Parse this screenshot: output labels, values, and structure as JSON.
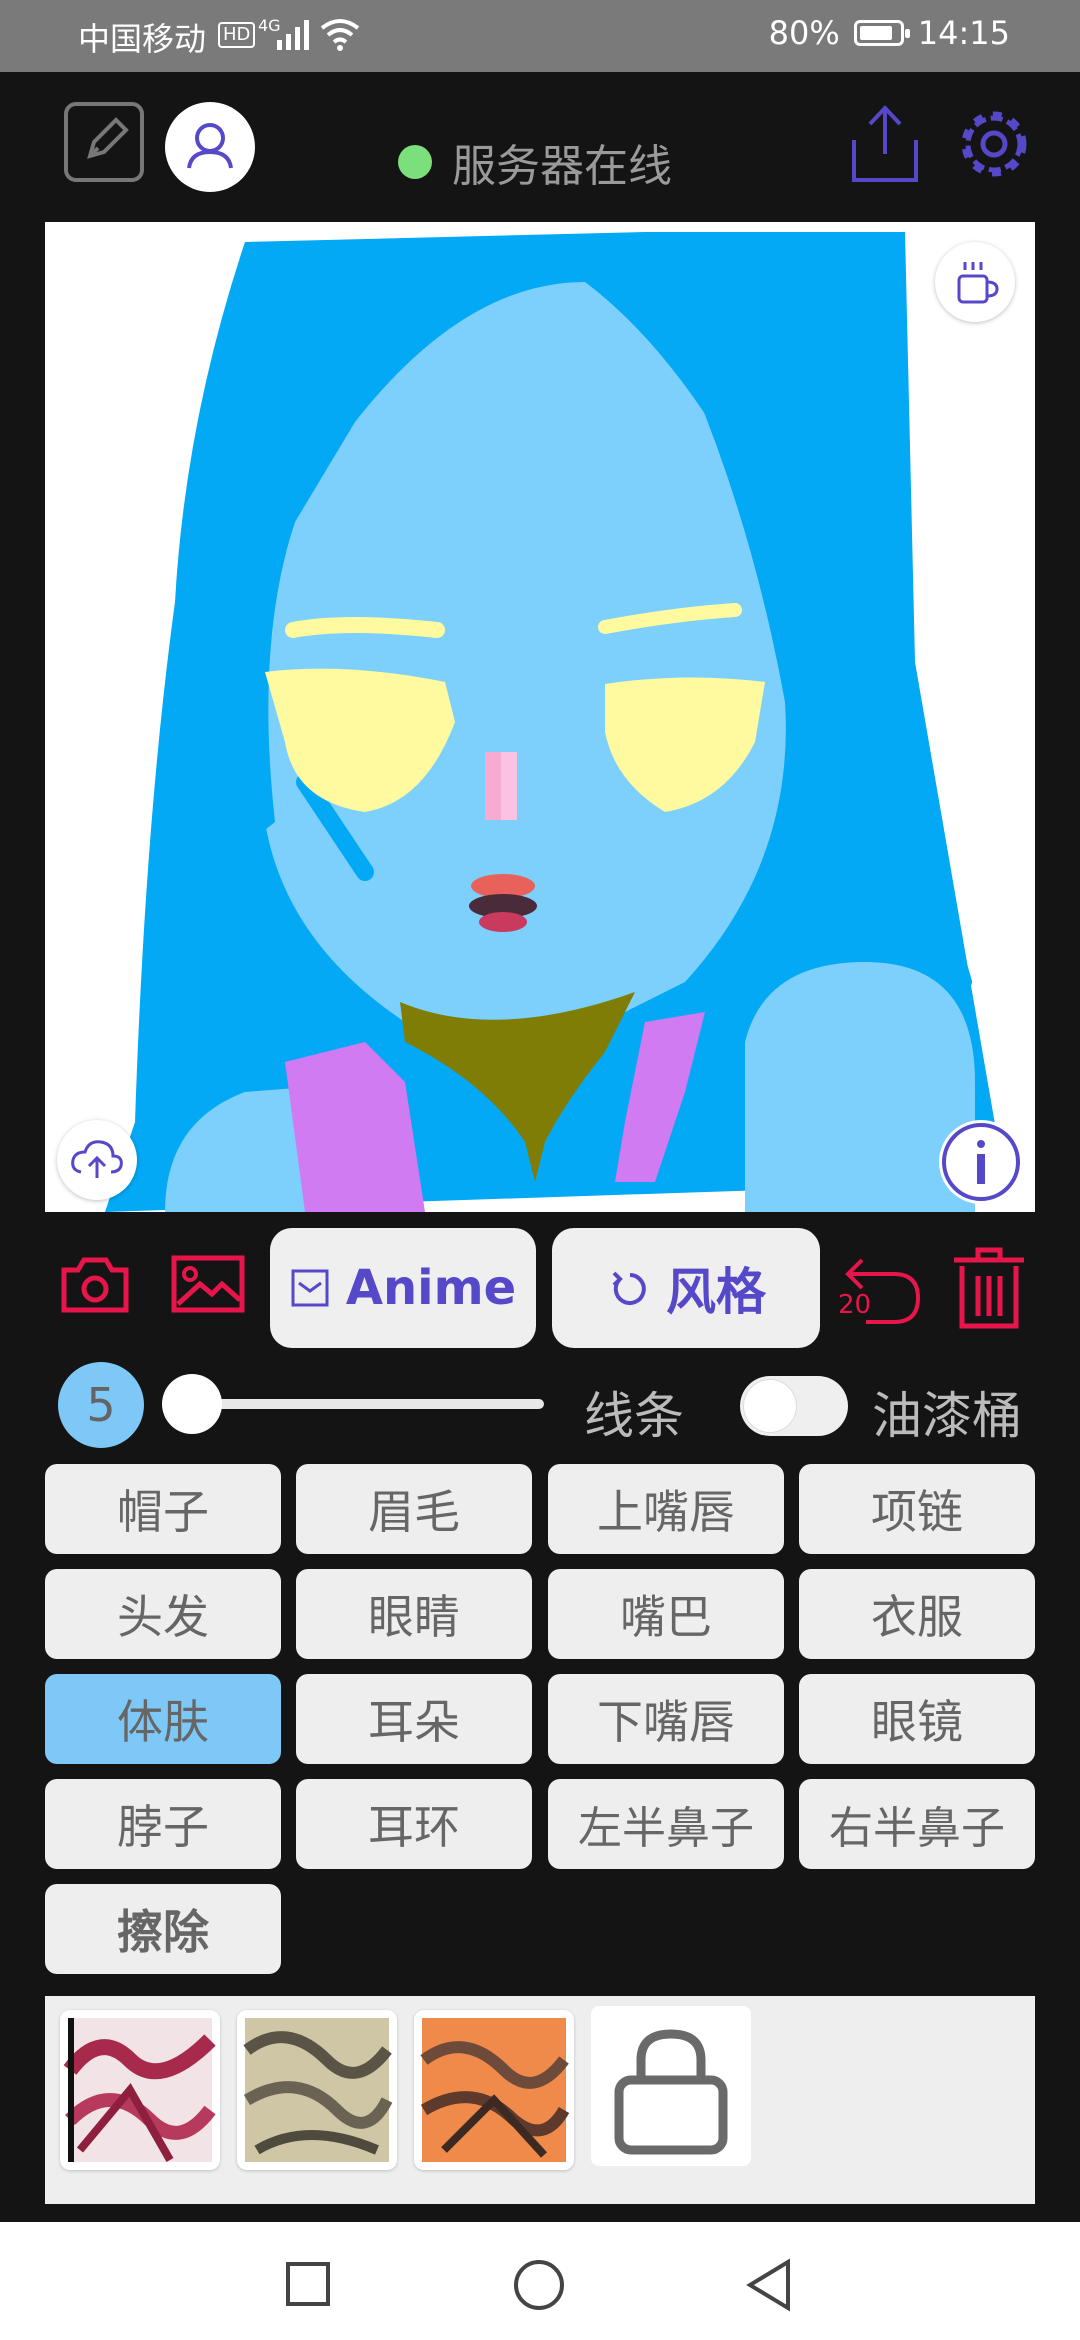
{
  "status_bar": {
    "carrier": "中国移动",
    "hd": "HD",
    "network": "4G",
    "battery": "80%",
    "time": "14:15"
  },
  "header": {
    "server_status": "服务器在线"
  },
  "tools": {
    "mode_label": "Anime",
    "style_label": "风格",
    "undo_count": "20"
  },
  "brush": {
    "size": "5",
    "lines_label": "线条",
    "bucket_label": "油漆桶"
  },
  "parts": [
    {
      "label": "帽子"
    },
    {
      "label": "眉毛"
    },
    {
      "label": "上嘴唇"
    },
    {
      "label": "项链"
    },
    {
      "label": "头发"
    },
    {
      "label": "眼睛"
    },
    {
      "label": "嘴巴"
    },
    {
      "label": "衣服"
    },
    {
      "label": "体肤"
    },
    {
      "label": "耳朵"
    },
    {
      "label": "下嘴唇"
    },
    {
      "label": "眼镜"
    },
    {
      "label": "脖子"
    },
    {
      "label": "耳环"
    },
    {
      "label": "左半鼻子"
    },
    {
      "label": "右半鼻子"
    },
    {
      "label": "擦除"
    }
  ],
  "active_part": "体肤",
  "colors": {
    "accent_purple": "#5649c9",
    "accent_red": "#e8154b",
    "highlight_blue": "#7ec8f7",
    "online_green": "#7be07b",
    "hair": "#03a9f4",
    "skin": "#7dd0fb",
    "eyes": "#fffa9f",
    "neck_item": "#7f7d06",
    "clothes": "#d17bf2"
  },
  "icons": [
    "edit-icon",
    "user-icon",
    "share-icon",
    "settings-icon",
    "coffee-icon",
    "upload-icon",
    "info-icon",
    "camera-icon",
    "image-icon",
    "checkbox-icon",
    "reset-icon",
    "undo-icon",
    "trash-icon",
    "lock-icon",
    "square-nav-icon",
    "circle-nav-icon",
    "back-nav-icon"
  ]
}
